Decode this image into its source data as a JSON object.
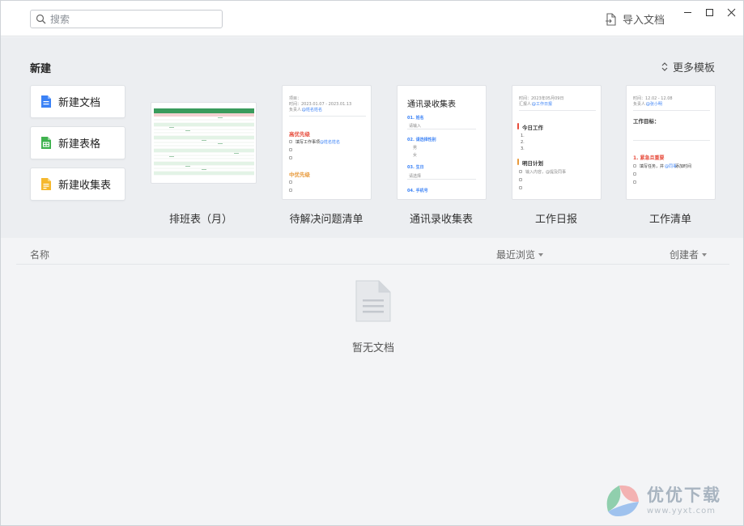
{
  "titlebar": {
    "search_placeholder": "搜索",
    "import_label": "导入文档"
  },
  "templates_section": {
    "title": "新建",
    "more_label": "更多模板",
    "new_buttons": [
      {
        "label": "新建文档",
        "icon": "doc-icon",
        "color": "#3b82f6"
      },
      {
        "label": "新建表格",
        "icon": "sheet-icon",
        "color": "#3fb24f"
      },
      {
        "label": "新建收集表",
        "icon": "form-icon",
        "color": "#f5b82e"
      }
    ],
    "templates": [
      {
        "label": "排班表（月）"
      },
      {
        "label": "待解决问题清单",
        "preview": {
          "meta1": "项目：",
          "meta2": "时间：2023.01.07 - 2023.01.13",
          "meta3_label": "负责人：",
          "meta3_value": "@姓名姓名",
          "section1": "高优先级",
          "item1_text": "填写工作事项",
          "item1_mention": "@姓名姓名",
          "section2": "中优先级"
        }
      },
      {
        "label": "通讯录收集表",
        "preview": {
          "title": "通讯录收集表",
          "q1": "01. 姓名",
          "q1_placeholder": "请输入",
          "q2": "02. 请选择性别",
          "q2_opt1": "男",
          "q2_opt2": "女",
          "q3": "03. 生日",
          "q3_placeholder": "请选择",
          "q4": "04. 手机号"
        }
      },
      {
        "label": "工作日报",
        "preview": {
          "meta1": "时间：2023年05月09日",
          "meta2_label": "汇报人：",
          "meta2_value": "@工作日报",
          "section1": "今日工作",
          "section2": "明日计划",
          "plan_item": "输入内容，@提及同事"
        }
      },
      {
        "label": "工作清单",
        "preview": {
          "meta1": "时间：12.02 - 12.08",
          "meta2_label": "负责人：",
          "meta2_value": "@张小明",
          "heading": "工作目标：",
          "section1": "1. 紧急且重要",
          "item1": "填写任务，并",
          "item1_mention": "@同事",
          "item1_tail": "添加时间"
        }
      }
    ]
  },
  "list": {
    "columns": {
      "name": "名称",
      "recent": "最近浏览",
      "creator": "创建者"
    },
    "empty_text": "暂无文档"
  },
  "watermark": {
    "title": "优优下载",
    "url": "www.yyxt.com"
  },
  "colors": {
    "accent_blue": "#3b82f6",
    "sheet_green": "#3fb24f",
    "form_yellow": "#f5b82e",
    "high_priority": "#e74c3c",
    "mid_priority": "#e89a3c"
  }
}
